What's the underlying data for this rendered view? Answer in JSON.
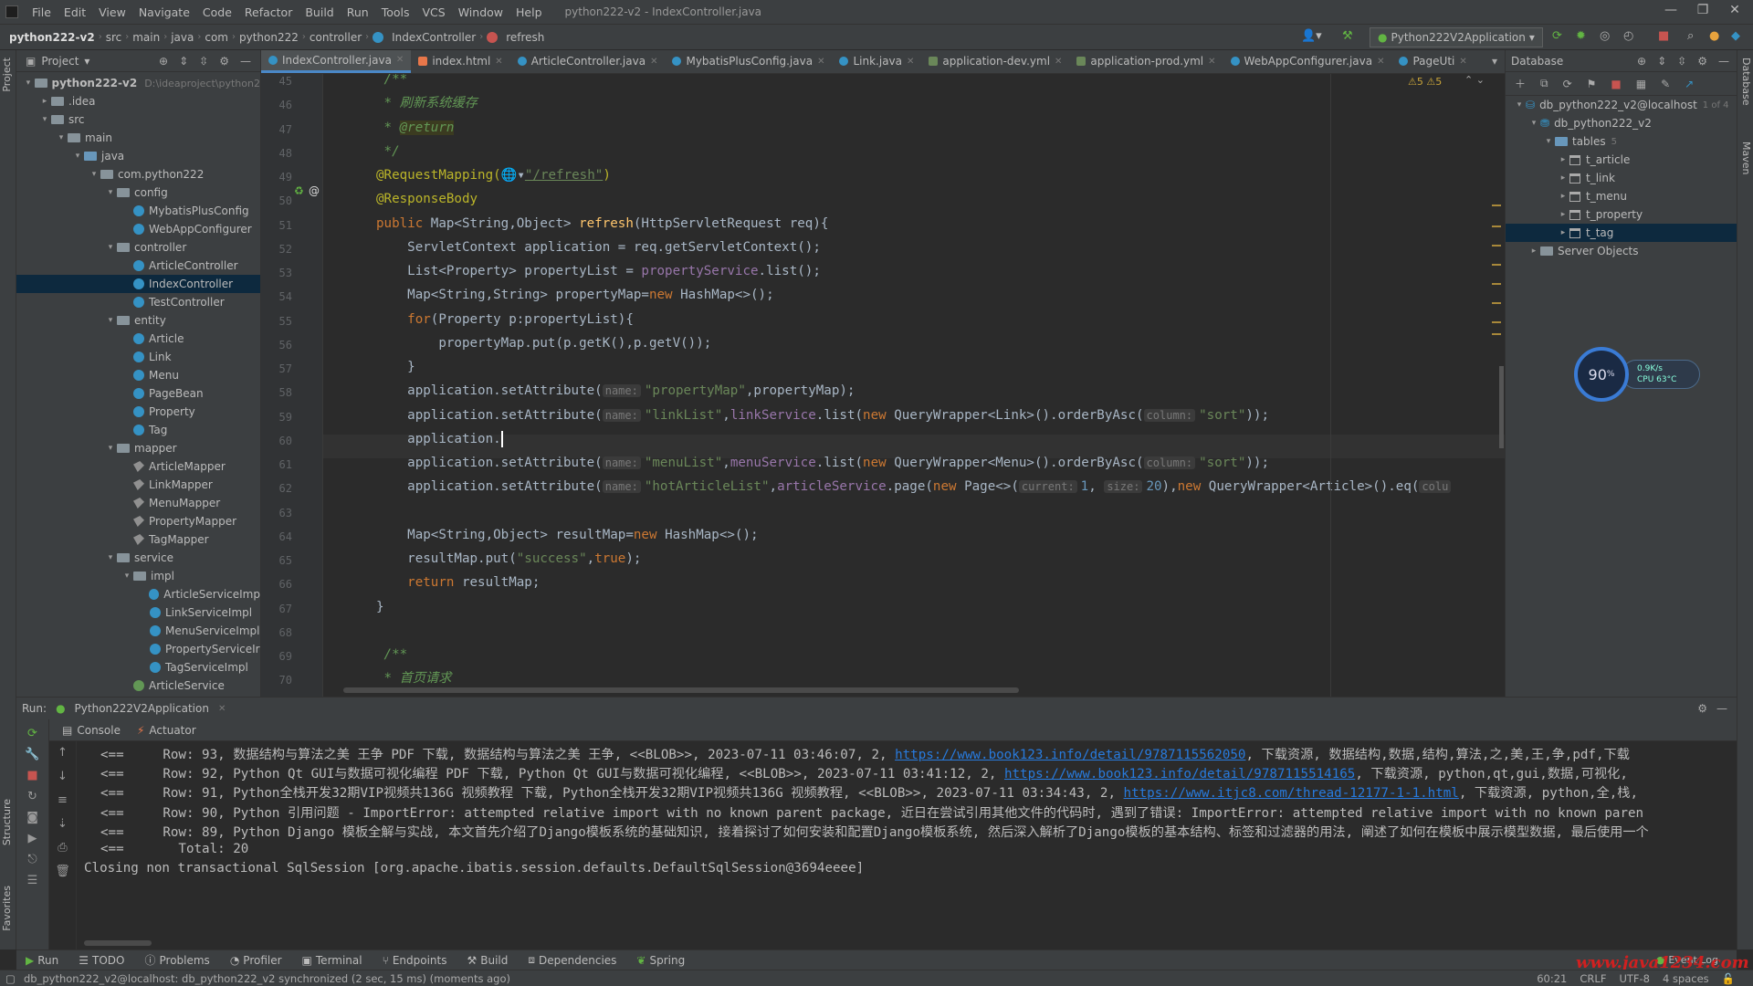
{
  "menu": [
    "File",
    "Edit",
    "View",
    "Navigate",
    "Code",
    "Refactor",
    "Build",
    "Run",
    "Tools",
    "VCS",
    "Window",
    "Help"
  ],
  "window_title": "python222-v2 - IndexController.java",
  "breadcrumb": [
    "python222-v2",
    "src",
    "main",
    "java",
    "com",
    "python222",
    "controller",
    "IndexController",
    "refresh"
  ],
  "run_config": "Python222V2Application",
  "project": {
    "header": "Project",
    "root": "python222-v2",
    "root_path": "D:\\ideaproject\\python2",
    "items": [
      {
        "label": "python222-v2",
        "indent": 0,
        "type": "folder",
        "arrow": "▾"
      },
      {
        "label": ".idea",
        "indent": 1,
        "type": "folder",
        "arrow": "▸"
      },
      {
        "label": "src",
        "indent": 1,
        "type": "folder",
        "arrow": "▾"
      },
      {
        "label": "main",
        "indent": 2,
        "type": "folder",
        "arrow": "▾"
      },
      {
        "label": "java",
        "indent": 3,
        "type": "folder-blue",
        "arrow": "▾"
      },
      {
        "label": "com.python222",
        "indent": 4,
        "type": "folder",
        "arrow": "▾"
      },
      {
        "label": "config",
        "indent": 5,
        "type": "folder",
        "arrow": "▾"
      },
      {
        "label": "MybatisPlusConfig",
        "indent": 6,
        "type": "class",
        "arrow": ""
      },
      {
        "label": "WebAppConfigurer",
        "indent": 6,
        "type": "class",
        "arrow": ""
      },
      {
        "label": "controller",
        "indent": 5,
        "type": "folder",
        "arrow": "▾"
      },
      {
        "label": "ArticleController",
        "indent": 6,
        "type": "class",
        "arrow": ""
      },
      {
        "label": "IndexController",
        "indent": 6,
        "type": "class",
        "arrow": "",
        "selected": true
      },
      {
        "label": "TestController",
        "indent": 6,
        "type": "class",
        "arrow": ""
      },
      {
        "label": "entity",
        "indent": 5,
        "type": "folder",
        "arrow": "▾"
      },
      {
        "label": "Article",
        "indent": 6,
        "type": "class",
        "arrow": ""
      },
      {
        "label": "Link",
        "indent": 6,
        "type": "class",
        "arrow": ""
      },
      {
        "label": "Menu",
        "indent": 6,
        "type": "class",
        "arrow": ""
      },
      {
        "label": "PageBean",
        "indent": 6,
        "type": "class",
        "arrow": ""
      },
      {
        "label": "Property",
        "indent": 6,
        "type": "class",
        "arrow": ""
      },
      {
        "label": "Tag",
        "indent": 6,
        "type": "class",
        "arrow": ""
      },
      {
        "label": "mapper",
        "indent": 5,
        "type": "folder",
        "arrow": "▾"
      },
      {
        "label": "ArticleMapper",
        "indent": 6,
        "type": "mapper",
        "arrow": ""
      },
      {
        "label": "LinkMapper",
        "indent": 6,
        "type": "mapper",
        "arrow": ""
      },
      {
        "label": "MenuMapper",
        "indent": 6,
        "type": "mapper",
        "arrow": ""
      },
      {
        "label": "PropertyMapper",
        "indent": 6,
        "type": "mapper",
        "arrow": ""
      },
      {
        "label": "TagMapper",
        "indent": 6,
        "type": "mapper",
        "arrow": ""
      },
      {
        "label": "service",
        "indent": 5,
        "type": "folder",
        "arrow": "▾"
      },
      {
        "label": "impl",
        "indent": 6,
        "type": "folder",
        "arrow": "▾"
      },
      {
        "label": "ArticleServiceImp",
        "indent": 7,
        "type": "class",
        "arrow": ""
      },
      {
        "label": "LinkServiceImpl",
        "indent": 7,
        "type": "class",
        "arrow": ""
      },
      {
        "label": "MenuServiceImpl",
        "indent": 7,
        "type": "class",
        "arrow": ""
      },
      {
        "label": "PropertyServiceIr",
        "indent": 7,
        "type": "class",
        "arrow": ""
      },
      {
        "label": "TagServiceImpl",
        "indent": 7,
        "type": "class",
        "arrow": ""
      },
      {
        "label": "ArticleService",
        "indent": 6,
        "type": "iface",
        "arrow": ""
      }
    ]
  },
  "tabs": [
    {
      "label": "IndexController.java",
      "kind": "java",
      "active": true
    },
    {
      "label": "index.html",
      "kind": "html"
    },
    {
      "label": "ArticleController.java",
      "kind": "java"
    },
    {
      "label": "MybatisPlusConfig.java",
      "kind": "java"
    },
    {
      "label": "Link.java",
      "kind": "java"
    },
    {
      "label": "application-dev.yml",
      "kind": "yml"
    },
    {
      "label": "application-prod.yml",
      "kind": "yml"
    },
    {
      "label": "WebAppConfigurer.java",
      "kind": "java"
    },
    {
      "label": "PageUti",
      "kind": "java"
    }
  ],
  "editor": {
    "line_numbers": [
      "45",
      "46",
      "47",
      "48",
      "49",
      "50",
      "51",
      "52",
      "53",
      "54",
      "55",
      "56",
      "57",
      "58",
      "59",
      "60",
      "61",
      "62",
      "63",
      "64",
      "65",
      "66",
      "67",
      "68",
      "69",
      "70"
    ],
    "warnings": "⚠5  ⚠5",
    "comment_text": "刷新系统缓存",
    "return_tag": "@return",
    "lines": {
      "l45": "/**",
      "l47_star": "* ",
      "l48": "*/",
      "l49_ann": "@RequestMapping(",
      "l49_url": "\"/refresh\"",
      "l49_end": ")",
      "l50": "@ResponseBody",
      "l51_pub": "public ",
      "l51_type": "Map<String,Object> ",
      "l51_fn": "refresh",
      "l51_args": "(HttpServletRequest req){",
      "l52": "ServletContext application = req.getServletContext();",
      "l53_a": "List<Property> propertyList = ",
      "l53_f": "propertyService",
      "l53_b": ".list();",
      "l54_a": "Map<String,String> propertyMap=",
      "l54_kw": "new ",
      "l54_b": "HashMap<>();",
      "l55_kw": "for",
      "l55_b": "(Property p:propertyList){",
      "l56": "propertyMap.put(p.getK(),p.getV());",
      "l57": "}",
      "l58_a": "application.setAttribute(",
      "l58_h": "name:",
      "l58_s": "\"propertyMap\"",
      "l58_b": ",propertyMap);",
      "l59_a": "application.setAttribute(",
      "l59_h": "name:",
      "l59_s": "\"linkList\"",
      "l59_f": "linkService",
      "l59_b": ".list(",
      "l59_kw": "new ",
      "l59_c": "QueryWrapper<Link>().orderByAsc(",
      "l59_h2": "column:",
      "l59_s2": "\"sort\"",
      "l59_d": "));",
      "l60": "application.",
      "l61_a": "application.setAttribute(",
      "l61_h": "name:",
      "l61_s": "\"menuList\"",
      "l61_f": "menuService",
      "l61_b": ".list(",
      "l61_kw": "new ",
      "l61_c": "QueryWrapper<Menu>().orderByAsc(",
      "l61_h2": "column:",
      "l61_s2": "\"sort\"",
      "l61_d": "));",
      "l62_a": "application.setAttribute(",
      "l62_h": "name:",
      "l62_s": "\"hotArticleList\"",
      "l62_f": "articleService",
      "l62_b": ".page(",
      "l62_kw": "new ",
      "l62_c": "Page<>(",
      "l62_h2": "current:",
      "l62_n1": "1",
      "l62_h3": "size:",
      "l62_n2": "20",
      "l62_d": "),",
      "l62_kw2": "new ",
      "l62_e": "QueryWrapper<Article>().eq(",
      "l62_h4": "colu",
      "l64_a": "Map<String,Object> resultMap=",
      "l64_kw": "new ",
      "l64_b": "HashMap<>();",
      "l65_a": "resultMap.put(",
      "l65_s": "\"success\"",
      "l65_kw": "true",
      "l65_b": ");",
      "l66_kw": "return ",
      "l66_b": "resultMap;",
      "l67": "}",
      "l69": "/**",
      "l70": "* 首页请求"
    }
  },
  "database": {
    "header": "Database",
    "connection": "db_python222_v2@localhost",
    "connection_count": "1 of 4",
    "schema": "db_python222_v2",
    "tables_label": "tables",
    "tables_count": "5",
    "tables": [
      "t_article",
      "t_link",
      "t_menu",
      "t_property",
      "t_tag"
    ],
    "selected_table": "t_tag",
    "server_objects": "Server Objects"
  },
  "cpu_widget": {
    "percent": "90",
    "unit": "%",
    "net": "0.9K/s",
    "cpu": "CPU 63°C"
  },
  "run": {
    "label": "Run:",
    "config": "Python222V2Application",
    "tabs": [
      "Console",
      "Actuator"
    ],
    "lines": [
      {
        "prefix": "<==",
        "text": "     Row: 93, 数据结构与算法之美 王争 PDF 下载, 数据结构与算法之美 王争, <<BLOB>>, 2023-07-11 03:46:07, 2, ",
        "link": "https://www.book123.info/detail/9787115562050",
        "tail": ", 下载资源, 数据结构,数据,结构,算法,之,美,王,争,pdf,下载"
      },
      {
        "prefix": "<==",
        "text": "     Row: 92, Python Qt GUI与数据可视化编程 PDF 下载, Python Qt GUI与数据可视化编程, <<BLOB>>, 2023-07-11 03:41:12, 2, ",
        "link": "https://www.book123.info/detail/9787115514165",
        "tail": ", 下载资源, python,qt,gui,数据,可视化,"
      },
      {
        "prefix": "<==",
        "text": "     Row: 91, Python全栈开发32期VIP视频共136G 视频教程 下载, Python全栈开发32期VIP视频共136G 视频教程, <<BLOB>>, 2023-07-11 03:34:43, 2, ",
        "link": "https://www.itjc8.com/thread-12177-1-1.html",
        "tail": ", 下载资源, python,全,栈,"
      },
      {
        "prefix": "<==",
        "text": "     Row: 90, Python 引用问题 - ImportError: attempted relative import with no known parent package, 近日在尝试引用其他文件的代码时, 遇到了错误: ImportError: attempted relative import with no known paren",
        "link": "",
        "tail": ""
      },
      {
        "prefix": "<==",
        "text": "     Row: 89, Python Django 模板全解与实战, 本文首先介绍了Django模板系统的基础知识, 接着探讨了如何安装和配置Django模板系统, 然后深入解析了Django模板的基本结构、标签和过滤器的用法, 阐述了如何在模板中展示模型数据, 最后使用一个",
        "link": "",
        "tail": ""
      },
      {
        "prefix": "<==",
        "text": "       Total: 20",
        "link": "",
        "tail": ""
      },
      {
        "prefix": "",
        "text": "Closing non transactional SqlSession [org.apache.ibatis.session.defaults.DefaultSqlSession@3694eeee]",
        "link": "",
        "tail": ""
      }
    ]
  },
  "toolwindows": [
    "Run",
    "TODO",
    "Problems",
    "Profiler",
    "Terminal",
    "Endpoints",
    "Build",
    "Dependencies",
    "Spring"
  ],
  "event_log": "Event Log",
  "status": {
    "message": "db_python222_v2@localhost: db_python222_v2 synchronized (2 sec, 15 ms) (moments ago)",
    "position": "60:21",
    "line_sep": "CRLF",
    "encoding": "UTF-8",
    "indent": "4 spaces"
  },
  "watermark": "www.java1234.com",
  "side_labels": {
    "project": "Project",
    "structure": "Structure",
    "favorites": "Favorites",
    "database": "Database",
    "maven": "Maven"
  }
}
